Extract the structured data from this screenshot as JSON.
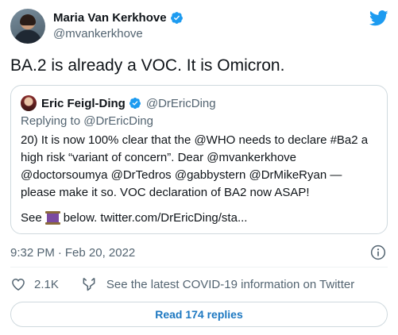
{
  "tweet": {
    "author_name": "Maria Van Kerkhove",
    "author_handle": "@mvankerkhove",
    "text": "BA.2 is already a VOC. It is Omicron.",
    "time": "9:32 PM",
    "separator": "·",
    "date": "Feb 20, 2022"
  },
  "quote": {
    "author_name": "Eric Feigl-Ding",
    "author_handle": "@DrEricDing",
    "replying_prefix": "Replying to",
    "replying_handle": "@DrEricDing",
    "body": "20) It is now 100% clear that the @WHO needs to declare #Ba2 a high risk “variant of concern”. Dear @mvankerkhove @doctorsoumya @DrTedros @gabbystern @DrMikeRyan — please make it so. VOC declaration of BA2 now ASAP!",
    "see_prefix": "See",
    "see_suffix": "below. twitter.com/DrEricDing/sta..."
  },
  "actions": {
    "like_count": "2.1K",
    "covid_link": "See the latest COVID-19 information on Twitter",
    "read_replies": "Read 174 replies"
  },
  "icons": {
    "verified": "verified-badge-icon",
    "twitter": "twitter-bird-icon",
    "info": "info-icon",
    "heart": "heart-icon",
    "covid": "covid-info-icon",
    "thread": "thread-icon"
  },
  "colors": {
    "accent": "#1d9bf0",
    "link": "#1d78c1",
    "secondary_text": "#536471",
    "border": "#cfd9de"
  }
}
